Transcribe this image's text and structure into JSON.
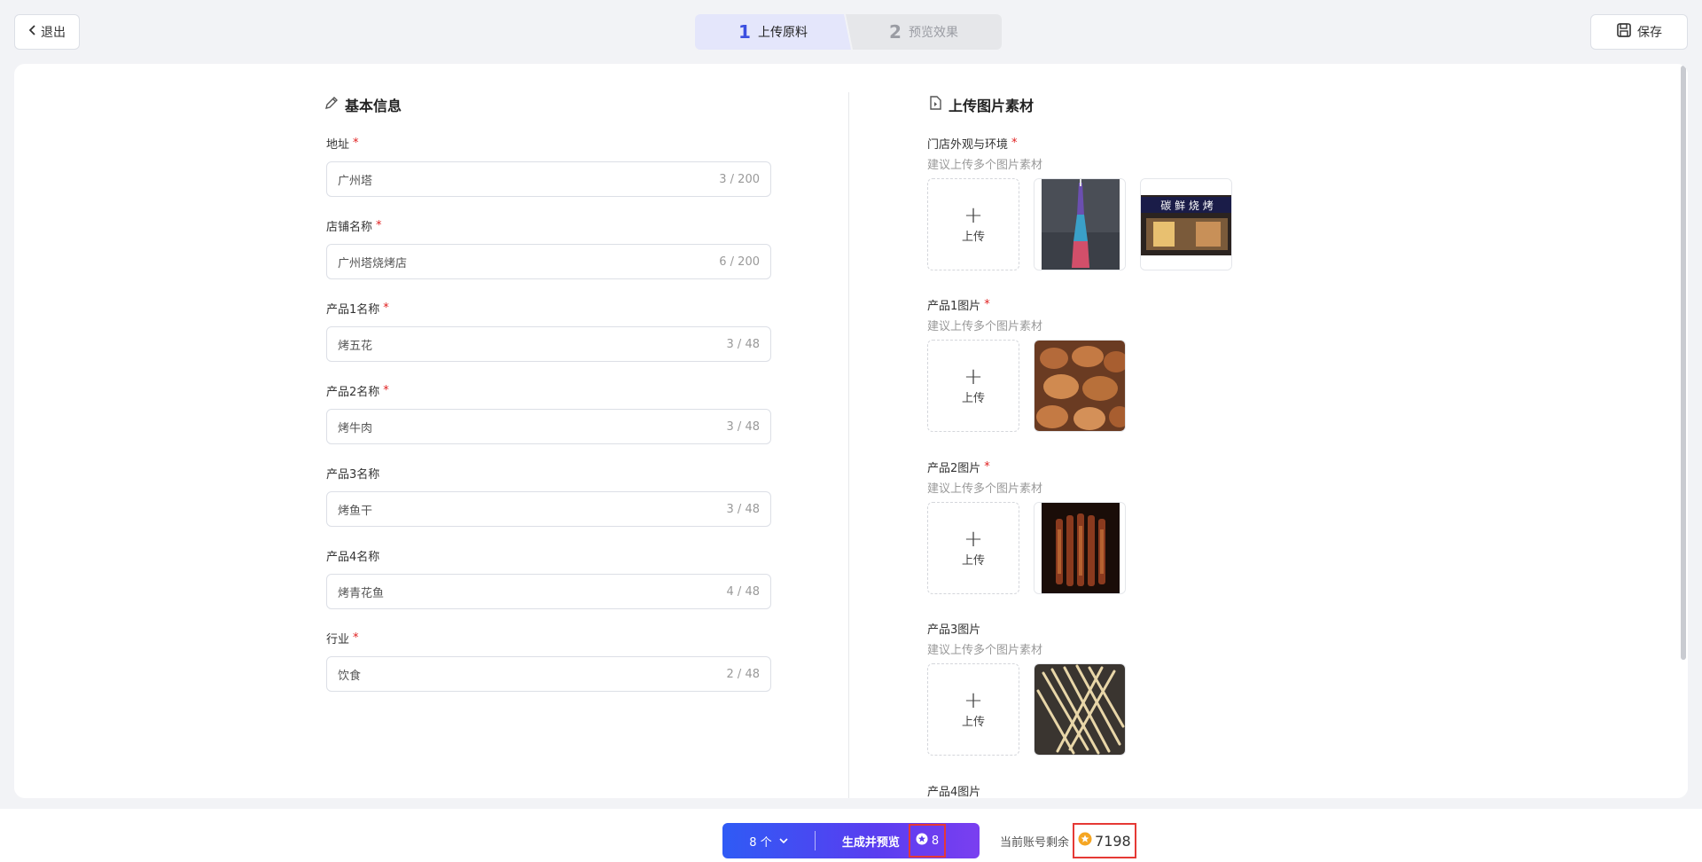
{
  "header": {
    "exit_label": "退出",
    "save_label": "保存",
    "steps": [
      {
        "num": "1",
        "label": "上传原料"
      },
      {
        "num": "2",
        "label": "预览效果"
      }
    ]
  },
  "basic_info": {
    "title": "基本信息",
    "fields": [
      {
        "label": "地址",
        "required": true,
        "value": "广州塔",
        "count": "3 / 200"
      },
      {
        "label": "店铺名称",
        "required": true,
        "value": "广州塔烧烤店",
        "count": "6 / 200"
      },
      {
        "label": "产品1名称",
        "required": true,
        "value": "烤五花",
        "count": "3 / 48"
      },
      {
        "label": "产品2名称",
        "required": true,
        "value": "烤牛肉",
        "count": "3 / 48"
      },
      {
        "label": "产品3名称",
        "required": false,
        "value": "烤鱼干",
        "count": "3 / 48"
      },
      {
        "label": "产品4名称",
        "required": false,
        "value": "烤青花鱼",
        "count": "4 / 48"
      },
      {
        "label": "行业",
        "required": true,
        "value": "饮食",
        "count": "2 / 48"
      }
    ]
  },
  "upload": {
    "title": "上传图片素材",
    "upload_label": "上传",
    "upload_plus": "+",
    "groups": [
      {
        "label": "门店外观与环境",
        "required": true,
        "hint": "建议上传多个图片素材",
        "images": [
          "canton-tower-photo",
          "bbq-storefront-photo"
        ],
        "storefront_sign": "碳 鲜 烧 烤"
      },
      {
        "label": "产品1图片",
        "required": true,
        "hint": "建议上传多个图片素材",
        "images": [
          "grilled-pork-belly-photo"
        ]
      },
      {
        "label": "产品2图片",
        "required": true,
        "hint": "建议上传多个图片素材",
        "images": [
          "beef-skewers-photo"
        ]
      },
      {
        "label": "产品3图片",
        "required": false,
        "hint": "建议上传多个图片素材",
        "images": [
          "dried-fish-photo"
        ]
      },
      {
        "label": "产品4图片",
        "required": false,
        "hint": "",
        "images": []
      }
    ]
  },
  "required_mark": "*",
  "bottom": {
    "count_label": "8 个",
    "generate_label": "生成并预览",
    "cost": "8",
    "balance_label": "当前账号剩余",
    "balance_value": "7198"
  },
  "colors": {
    "accent": "#3b4fe0",
    "required": "#e02020",
    "highlight_border": "#e53935",
    "coin": "#f5a623"
  }
}
